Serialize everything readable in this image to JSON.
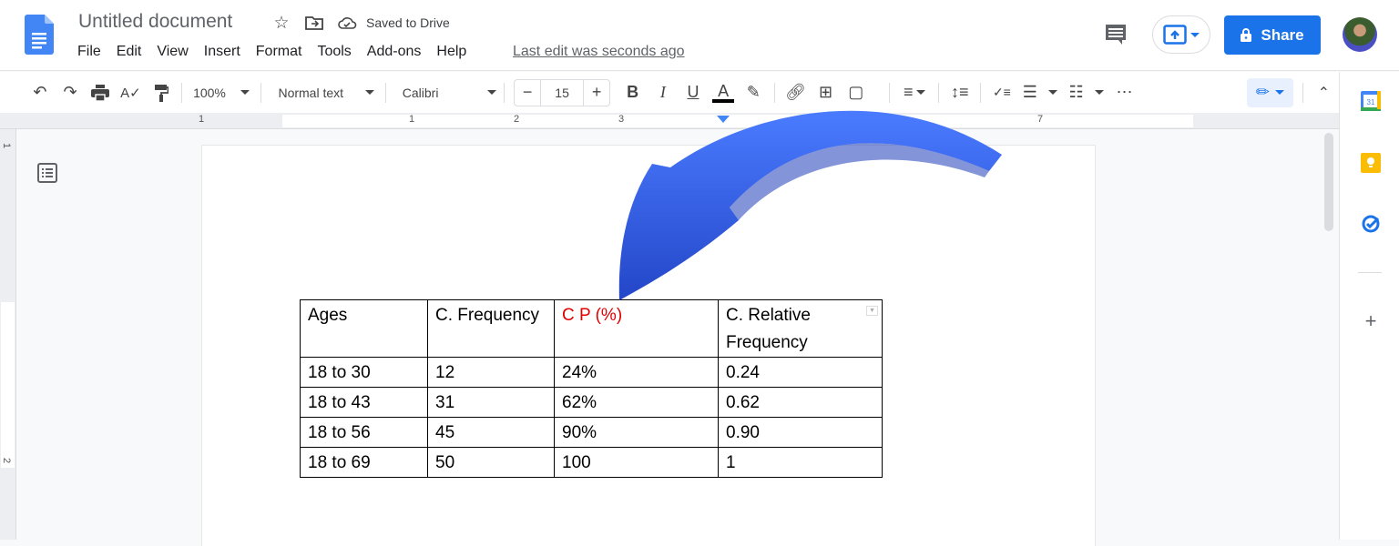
{
  "app": {
    "title": "Untitled document",
    "save_status": "Saved to Drive",
    "last_edit": "Last edit was seconds ago",
    "share_label": "Share"
  },
  "menu": [
    "File",
    "Edit",
    "View",
    "Insert",
    "Format",
    "Tools",
    "Add-ons",
    "Help"
  ],
  "toolbar": {
    "zoom": "100%",
    "style": "Normal text",
    "font": "Calibri",
    "font_size": "15",
    "text_color": "#000000"
  },
  "ruler": {
    "labels": [
      "1",
      "1",
      "2",
      "3",
      "7"
    ]
  },
  "vertical_ruler": {
    "labels": [
      "1",
      "2"
    ]
  },
  "side_panel": {
    "items": [
      "calendar",
      "keep",
      "tasks",
      "add"
    ],
    "calendar_day": "31"
  },
  "table": {
    "header": [
      "Ages",
      "C. Frequency",
      "C P (%)",
      "C. Relative Frequency"
    ],
    "header_colors": [
      "#000000",
      "#000000",
      "#e00000",
      "#000000"
    ],
    "rows": [
      [
        "18 to 30",
        "12",
        "24%",
        "0.24"
      ],
      [
        "18 to 43",
        "31",
        "62%",
        "0.62"
      ],
      [
        "18 to 56",
        "45",
        "90%",
        "0.90"
      ],
      [
        "18 to 69",
        "50",
        "100",
        "1"
      ]
    ]
  },
  "colors": {
    "accent": "#1a73e8",
    "arrow": "#3d6cf0"
  }
}
